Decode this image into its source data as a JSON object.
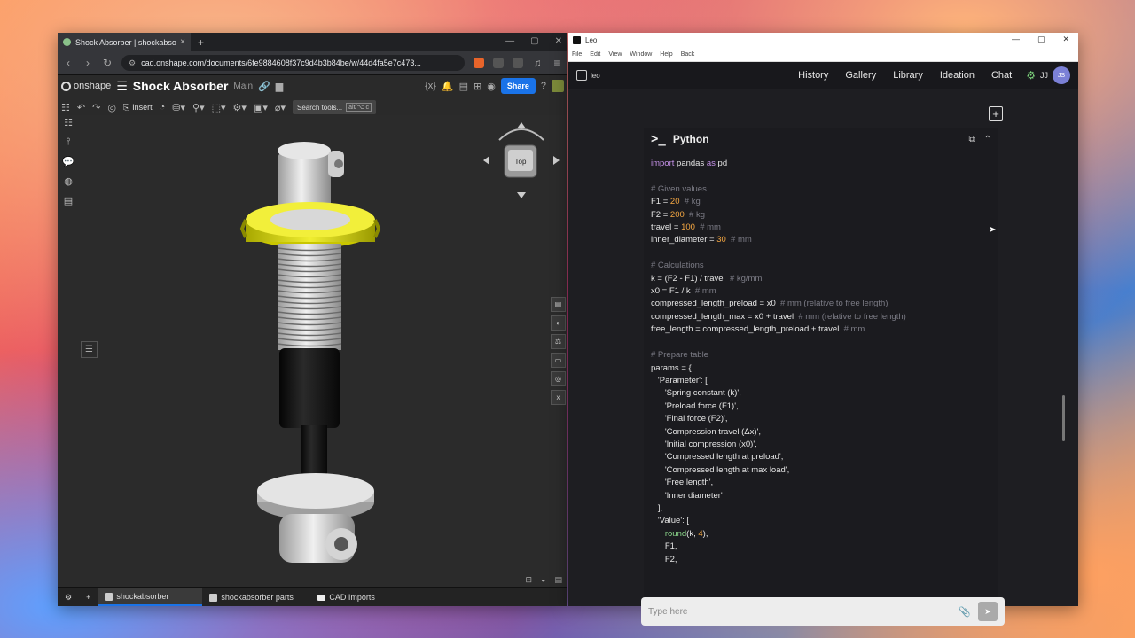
{
  "left_window": {
    "tab_title": "Shock Absorber | shockabsorber",
    "tab_close": "×",
    "tab_new": "+",
    "url": "cad.onshape.com/documents/6fe9884608f37c9d4b3b84be/w/44d4fa5e7c473...",
    "doc_title": "Shock Absorber",
    "branch": "Main",
    "logo_text": "onshape",
    "share_label": "Share",
    "insert_label": "Insert",
    "search_label": "Search tools...",
    "search_kbd": "alt/⌥ c",
    "viewcube_label": "Top",
    "tabs": [
      {
        "label": "shockabsorber"
      },
      {
        "label": "shockabsorber parts"
      },
      {
        "label": "CAD Imports"
      }
    ]
  },
  "right_window": {
    "app_title": "Leo",
    "menu": [
      "File",
      "Edit",
      "View",
      "Window",
      "Help",
      "Back"
    ],
    "brand": "leo",
    "nav": [
      "History",
      "Gallery",
      "Library",
      "Ideation",
      "Chat"
    ],
    "user_initials": "JJ",
    "avatar_initials": "JS",
    "code_lang": "Python",
    "prompt_placeholder": "Type here",
    "code_lines": [
      [
        [
          "kw",
          "import"
        ],
        [
          "t",
          " pandas "
        ],
        [
          "kw",
          "as"
        ],
        [
          "t",
          " pd"
        ]
      ],
      [],
      [
        [
          "cm",
          "# Given values"
        ]
      ],
      [
        [
          "t",
          "F1 = "
        ],
        [
          "num",
          "20"
        ],
        [
          "cm",
          "  # kg"
        ]
      ],
      [
        [
          "t",
          "F2 = "
        ],
        [
          "num",
          "200"
        ],
        [
          "cm",
          "  # kg"
        ]
      ],
      [
        [
          "t",
          "travel = "
        ],
        [
          "num",
          "100"
        ],
        [
          "cm",
          "  # mm"
        ]
      ],
      [
        [
          "t",
          "inner_diameter = "
        ],
        [
          "num",
          "30"
        ],
        [
          "cm",
          "  # mm"
        ]
      ],
      [],
      [
        [
          "cm",
          "# Calculations"
        ]
      ],
      [
        [
          "t",
          "k = (F2 - F1) / travel  "
        ],
        [
          "cm",
          "# kg/mm"
        ]
      ],
      [
        [
          "t",
          "x0 = F1 / k  "
        ],
        [
          "cm",
          "# mm"
        ]
      ],
      [
        [
          "t",
          "compressed_length_preload = x0  "
        ],
        [
          "cm",
          "# mm (relative to free length)"
        ]
      ],
      [
        [
          "t",
          "compressed_length_max = x0 + travel  "
        ],
        [
          "cm",
          "# mm (relative to free length)"
        ]
      ],
      [
        [
          "t",
          "free_length = compressed_length_preload + travel  "
        ],
        [
          "cm",
          "# mm"
        ]
      ],
      [],
      [
        [
          "cm",
          "# Prepare table"
        ]
      ],
      [
        [
          "t",
          "params = {"
        ]
      ],
      [
        [
          "t",
          "   'Parameter': ["
        ]
      ],
      [
        [
          "t",
          "      'Spring constant (k)',"
        ]
      ],
      [
        [
          "t",
          "      'Preload force (F1)',"
        ]
      ],
      [
        [
          "t",
          "      'Final force (F2)',"
        ]
      ],
      [
        [
          "t",
          "      'Compression travel (Δx)',"
        ]
      ],
      [
        [
          "t",
          "      'Initial compression (x0)',"
        ]
      ],
      [
        [
          "t",
          "      'Compressed length at preload',"
        ]
      ],
      [
        [
          "t",
          "      'Compressed length at max load',"
        ]
      ],
      [
        [
          "t",
          "      'Free length',"
        ]
      ],
      [
        [
          "t",
          "      'Inner diameter'"
        ]
      ],
      [
        [
          "t",
          "   ],"
        ]
      ],
      [
        [
          "t",
          "   'Value': ["
        ]
      ],
      [
        [
          "t",
          "      "
        ],
        [
          "fn",
          "round"
        ],
        [
          "t",
          "(k, "
        ],
        [
          "num",
          "4"
        ],
        [
          "t",
          "),"
        ]
      ],
      [
        [
          "t",
          "      F1,"
        ]
      ],
      [
        [
          "t",
          "      F2,"
        ]
      ]
    ]
  }
}
